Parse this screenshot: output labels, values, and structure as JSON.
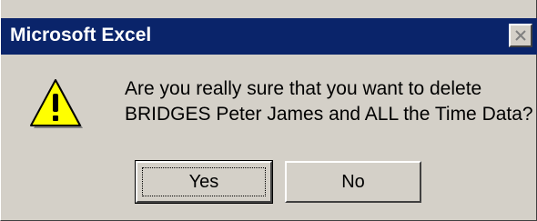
{
  "dialog": {
    "title": "Microsoft Excel",
    "close_icon": "close-icon",
    "warning_icon": "warning-icon",
    "message_line1": "Are you really sure that you want to delete",
    "message_line2": "BRIDGES Peter James and ALL the Time Data?",
    "buttons": {
      "yes_label": "Yes",
      "no_label": "No"
    }
  },
  "colors": {
    "titlebar": "#0a246a",
    "dialog_bg": "#d4d0c8",
    "icon_yellow": "#ffff00"
  }
}
